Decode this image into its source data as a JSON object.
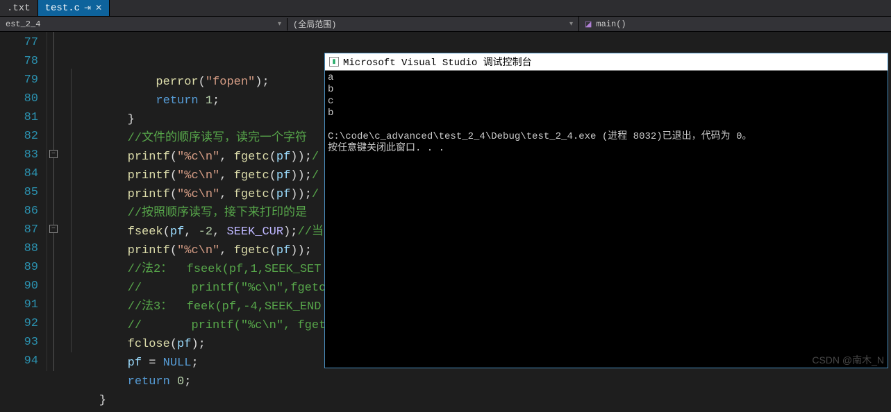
{
  "tabs": [
    {
      "label": ".txt",
      "active": false
    },
    {
      "label": "test.c",
      "active": true
    }
  ],
  "nav": {
    "left": "est_2_4",
    "mid": "(全局范围)",
    "right": "main()"
  },
  "lines": {
    "start": 77,
    "end": 94
  },
  "code": [
    {
      "n": 77,
      "segs": [
        [
          "pn",
          "            "
        ],
        [
          "fn",
          "perror"
        ],
        [
          "pn",
          "("
        ],
        [
          "str",
          "\"fopen\""
        ],
        [
          "pn",
          ");"
        ]
      ]
    },
    {
      "n": 78,
      "segs": [
        [
          "pn",
          "            "
        ],
        [
          "kw",
          "return"
        ],
        [
          "pn",
          " "
        ],
        [
          "num",
          "1"
        ],
        [
          "pn",
          ";"
        ]
      ]
    },
    {
      "n": 79,
      "segs": [
        [
          "pn",
          "        }"
        ]
      ]
    },
    {
      "n": 80,
      "segs": [
        [
          "pn",
          "        "
        ],
        [
          "cmt",
          "//文件的顺序读写，读完一个字符"
        ]
      ]
    },
    {
      "n": 81,
      "segs": [
        [
          "pn",
          "        "
        ],
        [
          "fn",
          "printf"
        ],
        [
          "pn",
          "("
        ],
        [
          "str",
          "\"%c\\n\""
        ],
        [
          "pn",
          ", "
        ],
        [
          "fn",
          "fgetc"
        ],
        [
          "pn",
          "("
        ],
        [
          "id",
          "pf"
        ],
        [
          "pn",
          "));"
        ],
        [
          "cmt",
          "/"
        ]
      ]
    },
    {
      "n": 82,
      "segs": [
        [
          "pn",
          "        "
        ],
        [
          "fn",
          "printf"
        ],
        [
          "pn",
          "("
        ],
        [
          "str",
          "\"%c\\n\""
        ],
        [
          "pn",
          ", "
        ],
        [
          "fn",
          "fgetc"
        ],
        [
          "pn",
          "("
        ],
        [
          "id",
          "pf"
        ],
        [
          "pn",
          "));"
        ],
        [
          "cmt",
          "/"
        ]
      ]
    },
    {
      "n": 83,
      "segs": [
        [
          "pn",
          "        "
        ],
        [
          "fn",
          "printf"
        ],
        [
          "pn",
          "("
        ],
        [
          "str",
          "\"%c\\n\""
        ],
        [
          "pn",
          ", "
        ],
        [
          "fn",
          "fgetc"
        ],
        [
          "pn",
          "("
        ],
        [
          "id",
          "pf"
        ],
        [
          "pn",
          "));"
        ],
        [
          "cmt",
          "/"
        ]
      ]
    },
    {
      "n": 84,
      "segs": [
        [
          "pn",
          "        "
        ],
        [
          "cmt",
          "//按照顺序读写，接下来打印的是"
        ]
      ]
    },
    {
      "n": 85,
      "segs": [
        [
          "pn",
          "        "
        ],
        [
          "fn",
          "fseek"
        ],
        [
          "pn",
          "("
        ],
        [
          "id",
          "pf"
        ],
        [
          "pn",
          ", "
        ],
        [
          "num",
          "-2"
        ],
        [
          "pn",
          ", "
        ],
        [
          "mac",
          "SEEK_CUR"
        ],
        [
          "pn",
          ");"
        ],
        [
          "cmt",
          "//当"
        ]
      ]
    },
    {
      "n": 86,
      "segs": [
        [
          "pn",
          "        "
        ],
        [
          "fn",
          "printf"
        ],
        [
          "pn",
          "("
        ],
        [
          "str",
          "\"%c\\n\""
        ],
        [
          "pn",
          ", "
        ],
        [
          "fn",
          "fgetc"
        ],
        [
          "pn",
          "("
        ],
        [
          "id",
          "pf"
        ],
        [
          "pn",
          "));"
        ]
      ]
    },
    {
      "n": 87,
      "segs": [
        [
          "pn",
          "        "
        ],
        [
          "cmt",
          "//法2：  fseek(pf,1,SEEK_SET"
        ]
      ]
    },
    {
      "n": 88,
      "segs": [
        [
          "pn",
          "        "
        ],
        [
          "cmt",
          "//       printf(\"%c\\n\",fgetc"
        ]
      ]
    },
    {
      "n": 89,
      "segs": [
        [
          "pn",
          "        "
        ],
        [
          "cmt",
          "//法3：  feek(pf,-4,SEEK_END"
        ]
      ]
    },
    {
      "n": 90,
      "segs": [
        [
          "pn",
          "        "
        ],
        [
          "cmt",
          "//       printf(\"%c\\n\", fget"
        ]
      ]
    },
    {
      "n": 91,
      "segs": [
        [
          "pn",
          "        "
        ],
        [
          "fn",
          "fclose"
        ],
        [
          "pn",
          "("
        ],
        [
          "id",
          "pf"
        ],
        [
          "pn",
          ");"
        ]
      ]
    },
    {
      "n": 92,
      "segs": [
        [
          "pn",
          "        "
        ],
        [
          "id",
          "pf"
        ],
        [
          "pn",
          " = "
        ],
        [
          "kw",
          "NULL"
        ],
        [
          "pn",
          ";"
        ]
      ]
    },
    {
      "n": 93,
      "segs": [
        [
          "pn",
          "        "
        ],
        [
          "kw",
          "return"
        ],
        [
          "pn",
          " "
        ],
        [
          "num",
          "0"
        ],
        [
          "pn",
          ";"
        ]
      ]
    },
    {
      "n": 94,
      "segs": [
        [
          "pn",
          "    }"
        ]
      ]
    }
  ],
  "fold_boxes": [
    {
      "line": 83,
      "glyph": "−"
    },
    {
      "line": 87,
      "glyph": "−"
    }
  ],
  "console": {
    "title": "Microsoft Visual Studio 调试控制台",
    "output": "a\nb\nc\nb\n\nC:\\code\\c_advanced\\test_2_4\\Debug\\test_2_4.exe (进程 8032)已退出，代码为 0。\n按任意键关闭此窗口. . ."
  },
  "watermark": "CSDN @南木_N"
}
